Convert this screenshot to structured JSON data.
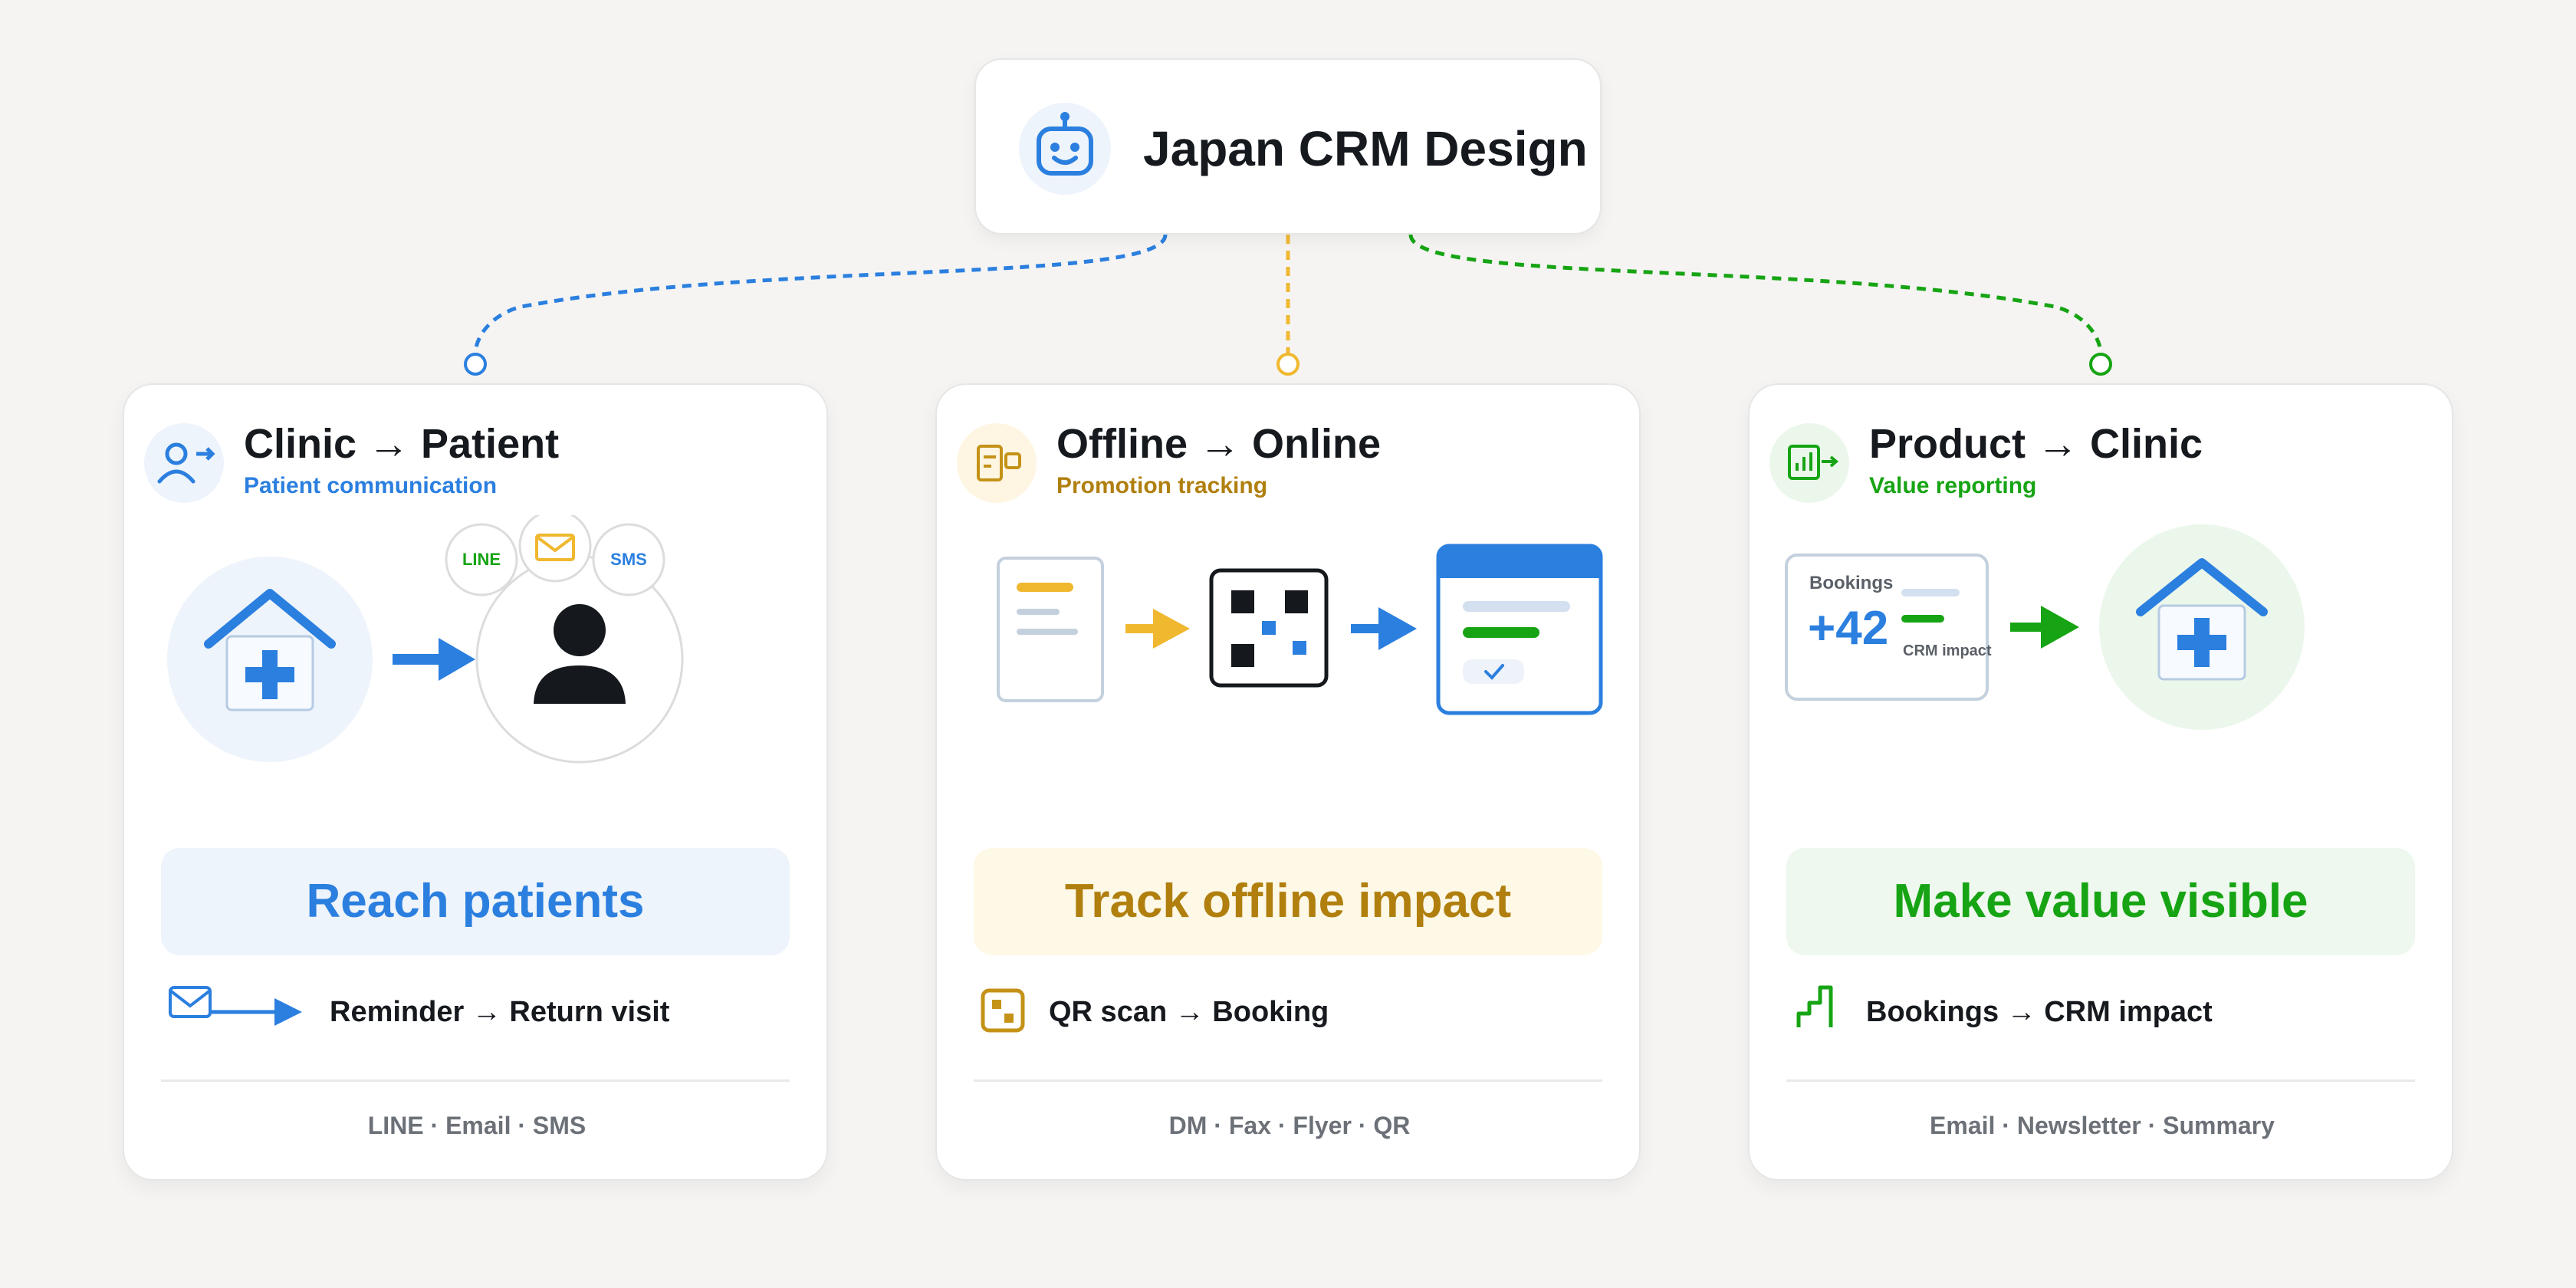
{
  "root": {
    "title": "Japan CRM Design",
    "icon": "robot-face-icon"
  },
  "colors": {
    "blue": "#2b7fdf",
    "gold": "#b07f0e",
    "gold_accent": "#f0b82f",
    "green": "#17a414",
    "background": "#f5f4f3",
    "text": "#16191d",
    "muted": "#6c7178"
  },
  "cards": [
    {
      "title": "Clinic → Patient",
      "subtitle": "Patient communication",
      "header_icon": "user-arrow-icon",
      "illustration": {
        "badges": [
          "LINE",
          "SMS"
        ],
        "badge_icon": "envelope-icon"
      },
      "banner": "Reach patients",
      "feature": "Reminder → Return visit",
      "feature_icon": "envelope-arrow-icon",
      "channels": "LINE · Email · SMS",
      "accent": "#2b7fdf"
    },
    {
      "title": "Offline → Online",
      "subtitle": "Promotion tracking",
      "header_icon": "flyer-icon",
      "illustration": {},
      "banner": "Track offline impact",
      "feature": "QR scan → Booking",
      "feature_icon": "qr-icon",
      "channels": "DM · Fax · Flyer · QR",
      "accent": "#b07f0e"
    },
    {
      "title": "Product → Clinic",
      "subtitle": "Value reporting",
      "header_icon": "chart-arrow-icon",
      "illustration": {
        "label": "Bookings",
        "value": "+42",
        "caption": "CRM impact"
      },
      "banner": "Make value visible",
      "feature": "Bookings → CRM impact",
      "feature_icon": "step-chart-icon",
      "channels": "Email · Newsletter · Summary",
      "accent": "#17a414"
    }
  ]
}
